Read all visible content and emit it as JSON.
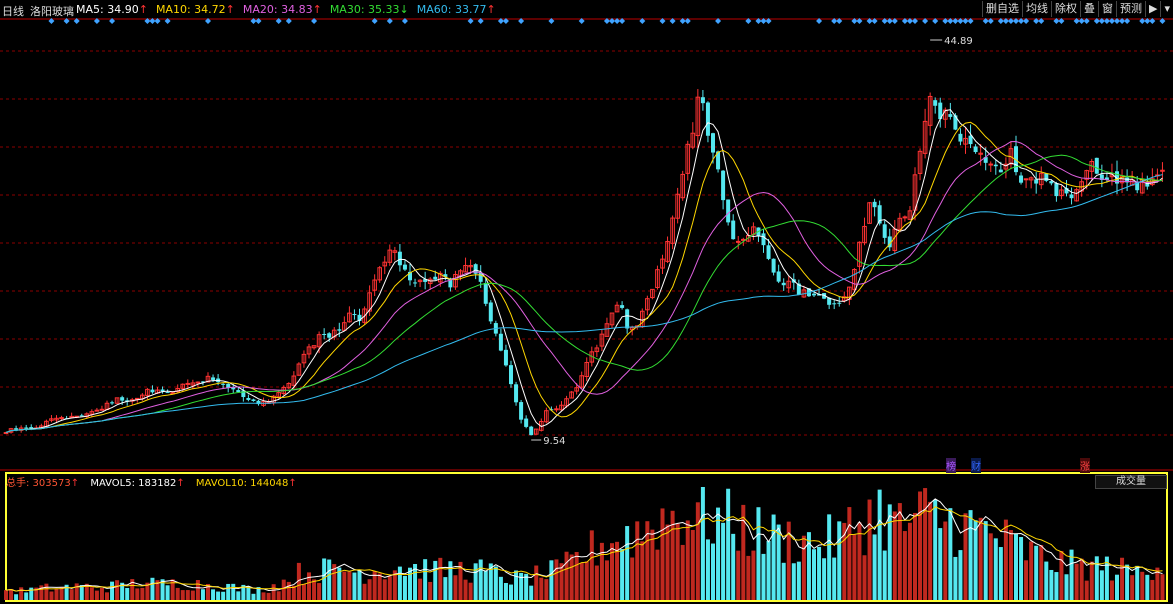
{
  "header": {
    "period": "日线",
    "stock_name": "洛阳玻璃",
    "ma": [
      {
        "label": "MA5",
        "value": "34.90",
        "arrow": "↑",
        "color": "#ffffff",
        "arrow_color": "#ff3333"
      },
      {
        "label": "MA10",
        "value": "34.72",
        "arrow": "↑",
        "color": "#ffd700",
        "arrow_color": "#ff3333"
      },
      {
        "label": "MA20",
        "value": "34.83",
        "arrow": "↑",
        "color": "#e060e0",
        "arrow_color": "#ff3333"
      },
      {
        "label": "MA30",
        "value": "35.33",
        "arrow": "↓",
        "color": "#33dd33",
        "arrow_color": "#33dd33"
      },
      {
        "label": "MA60",
        "value": "33.77",
        "arrow": "↑",
        "color": "#33bbee",
        "arrow_color": "#ff3333"
      }
    ]
  },
  "toolbar": {
    "items": [
      "删自选",
      "均线",
      "除权",
      "叠",
      "窗",
      "预测",
      "▶",
      "▾"
    ]
  },
  "volume_header": {
    "vol_label": "总手: 303573",
    "vol_arrow": "↑",
    "mavol5_label": "MAVOL5: 183182",
    "mavol5_arrow": "↑",
    "mavol10_label": "MAVOL10: 144048",
    "mavol10_arrow": "↑",
    "button_label": "成交量"
  },
  "markers": [
    {
      "text": "榜",
      "color": "#aa55ff"
    },
    {
      "text": "财",
      "color": "#3366ff"
    },
    {
      "text": "涨",
      "color": "#ff4444"
    }
  ],
  "annotations": {
    "high": "44.89",
    "low": "9.54"
  },
  "colors": {
    "up": "#ff3333",
    "down": "#55e8f0",
    "ma5": "#ffffff",
    "ma10": "#ffd700",
    "ma20": "#e060e0",
    "ma30": "#33dd33",
    "ma60": "#33bbee",
    "vol_border": "#ffff33",
    "grid": "#8b0000",
    "signal": "#3fa3ff"
  },
  "chart_data": {
    "type": "candlestick",
    "ylim": [
      7.5,
      48.5
    ],
    "price_points": [
      [
        0,
        10.7
      ],
      [
        10,
        10.9
      ],
      [
        20,
        11.0
      ],
      [
        30,
        11.1
      ],
      [
        40,
        11.4
      ],
      [
        50,
        11.8
      ],
      [
        60,
        12.2
      ],
      [
        70,
        12.0
      ],
      [
        80,
        12.4
      ],
      [
        90,
        12.6
      ],
      [
        100,
        12.9
      ],
      [
        110,
        13.4
      ],
      [
        120,
        13.9
      ],
      [
        130,
        13.7
      ],
      [
        140,
        14.1
      ],
      [
        150,
        14.6
      ],
      [
        160,
        14.9
      ],
      [
        170,
        14.4
      ],
      [
        180,
        14.9
      ],
      [
        190,
        15.2
      ],
      [
        200,
        15.4
      ],
      [
        210,
        15.7
      ],
      [
        220,
        15.2
      ],
      [
        230,
        14.8
      ],
      [
        240,
        14.2
      ],
      [
        250,
        13.6
      ],
      [
        260,
        13.2
      ],
      [
        270,
        13.7
      ],
      [
        280,
        14.3
      ],
      [
        290,
        15.4
      ],
      [
        300,
        17.0
      ],
      [
        310,
        18.5
      ],
      [
        320,
        19.8
      ],
      [
        330,
        19.4
      ],
      [
        340,
        20.4
      ],
      [
        350,
        21.8
      ],
      [
        360,
        21.0
      ],
      [
        370,
        23.6
      ],
      [
        380,
        25.6
      ],
      [
        390,
        27.5
      ],
      [
        400,
        26.5
      ],
      [
        410,
        25.0
      ],
      [
        420,
        24.5
      ],
      [
        430,
        24.8
      ],
      [
        440,
        25.0
      ],
      [
        450,
        24.2
      ],
      [
        460,
        25.3
      ],
      [
        470,
        26.1
      ],
      [
        480,
        24.6
      ],
      [
        490,
        21.5
      ],
      [
        500,
        18.6
      ],
      [
        510,
        15.6
      ],
      [
        520,
        12.2
      ],
      [
        530,
        10.4
      ],
      [
        540,
        11.6
      ],
      [
        550,
        13.1
      ],
      [
        560,
        12.9
      ],
      [
        570,
        14.0
      ],
      [
        580,
        15.3
      ],
      [
        590,
        17.8
      ],
      [
        600,
        19.2
      ],
      [
        610,
        21.2
      ],
      [
        620,
        22.4
      ],
      [
        630,
        19.8
      ],
      [
        640,
        21.0
      ],
      [
        650,
        23.5
      ],
      [
        660,
        26.0
      ],
      [
        670,
        29.5
      ],
      [
        680,
        33.5
      ],
      [
        690,
        37.5
      ],
      [
        700,
        42.0
      ],
      [
        710,
        37.5
      ],
      [
        720,
        34.0
      ],
      [
        730,
        29.0
      ],
      [
        740,
        27.5
      ],
      [
        750,
        29.4
      ],
      [
        760,
        28.6
      ],
      [
        770,
        26.1
      ],
      [
        780,
        24.1
      ],
      [
        790,
        25.0
      ],
      [
        800,
        23.6
      ],
      [
        810,
        23.1
      ],
      [
        820,
        23.0
      ],
      [
        830,
        22.7
      ],
      [
        840,
        22.6
      ],
      [
        850,
        24.0
      ],
      [
        860,
        28.5
      ],
      [
        870,
        32.0
      ],
      [
        880,
        29.5
      ],
      [
        890,
        28.1
      ],
      [
        900,
        30.0
      ],
      [
        910,
        31.5
      ],
      [
        920,
        37.0
      ],
      [
        930,
        42.0
      ],
      [
        940,
        40.0
      ],
      [
        950,
        39.4
      ],
      [
        960,
        37.9
      ],
      [
        970,
        37.0
      ],
      [
        980,
        36.0
      ],
      [
        990,
        35.5
      ],
      [
        1000,
        35.0
      ],
      [
        1010,
        36.4
      ],
      [
        1020,
        34.0
      ],
      [
        1030,
        33.4
      ],
      [
        1040,
        34.4
      ],
      [
        1050,
        33.5
      ],
      [
        1060,
        32.6
      ],
      [
        1070,
        32.0
      ],
      [
        1080,
        33.4
      ],
      [
        1090,
        35.4
      ],
      [
        1100,
        34.0
      ],
      [
        1110,
        33.7
      ],
      [
        1120,
        34.1
      ],
      [
        1130,
        33.5
      ],
      [
        1140,
        33.4
      ],
      [
        1150,
        34.0
      ],
      [
        1160,
        34.9
      ]
    ],
    "volume_points": [
      [
        0,
        0.1
      ],
      [
        20,
        0.08
      ],
      [
        40,
        0.1
      ],
      [
        60,
        0.11
      ],
      [
        80,
        0.12
      ],
      [
        100,
        0.11
      ],
      [
        120,
        0.13
      ],
      [
        140,
        0.15
      ],
      [
        160,
        0.14
      ],
      [
        180,
        0.15
      ],
      [
        200,
        0.14
      ],
      [
        220,
        0.13
      ],
      [
        240,
        0.1
      ],
      [
        260,
        0.09
      ],
      [
        280,
        0.14
      ],
      [
        300,
        0.24
      ],
      [
        320,
        0.26
      ],
      [
        340,
        0.28
      ],
      [
        360,
        0.25
      ],
      [
        380,
        0.27
      ],
      [
        400,
        0.3
      ],
      [
        420,
        0.28
      ],
      [
        440,
        0.26
      ],
      [
        460,
        0.27
      ],
      [
        480,
        0.26
      ],
      [
        500,
        0.22
      ],
      [
        520,
        0.18
      ],
      [
        540,
        0.22
      ],
      [
        560,
        0.26
      ],
      [
        580,
        0.38
      ],
      [
        600,
        0.48
      ],
      [
        620,
        0.55
      ],
      [
        640,
        0.6
      ],
      [
        660,
        0.72
      ],
      [
        680,
        0.75
      ],
      [
        700,
        0.78
      ],
      [
        720,
        0.7
      ],
      [
        740,
        0.66
      ],
      [
        760,
        0.58
      ],
      [
        780,
        0.55
      ],
      [
        800,
        0.52
      ],
      [
        820,
        0.5
      ],
      [
        840,
        0.55
      ],
      [
        860,
        0.7
      ],
      [
        880,
        0.78
      ],
      [
        900,
        0.65
      ],
      [
        920,
        0.74
      ],
      [
        940,
        0.72
      ],
      [
        960,
        0.66
      ],
      [
        980,
        0.63
      ],
      [
        1000,
        0.55
      ],
      [
        1020,
        0.45
      ],
      [
        1040,
        0.38
      ],
      [
        1060,
        0.32
      ],
      [
        1080,
        0.3
      ],
      [
        1100,
        0.3
      ],
      [
        1120,
        0.27
      ],
      [
        1140,
        0.24
      ],
      [
        1160,
        0.36
      ]
    ]
  }
}
